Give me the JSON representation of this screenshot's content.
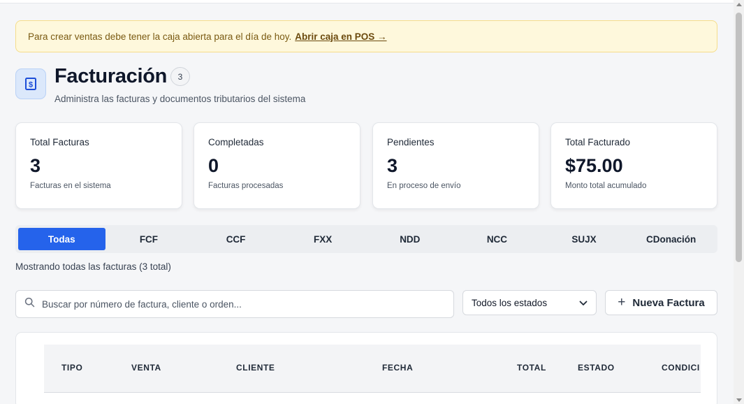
{
  "alert": {
    "message": "Para crear ventas debe tener la caja abierta para el día de hoy.",
    "link": "Abrir caja en POS →"
  },
  "header": {
    "icon": "dollar-receipt-icon",
    "title": "Facturación",
    "count": "3",
    "subtitle": "Administra las facturas y documentos tributarios del sistema"
  },
  "stats": [
    {
      "label": "Total Facturas",
      "value": "3",
      "desc": "Facturas en el sistema"
    },
    {
      "label": "Completadas",
      "value": "0",
      "desc": "Facturas procesadas"
    },
    {
      "label": "Pendientes",
      "value": "3",
      "desc": "En proceso de envío"
    },
    {
      "label": "Total Facturado",
      "value": "$75.00",
      "desc": "Monto total acumulado"
    }
  ],
  "tabs": [
    "Todas",
    "FCF",
    "CCF",
    "FXX",
    "NDD",
    "NCC",
    "SUJX",
    "CDonación"
  ],
  "showing": "Mostrando todas las facturas (3 total)",
  "search": {
    "placeholder": "Buscar por número de factura, cliente o orden..."
  },
  "status_filter": {
    "selected": "Todos los estados"
  },
  "new_button": {
    "label": "Nueva Factura"
  },
  "table": {
    "headers": [
      "TIPO",
      "VENTA",
      "CLIENTE",
      "FECHA",
      "TOTAL",
      "ESTADO",
      "CONDICI"
    ]
  },
  "colors": {
    "accent": "#2563eb",
    "alert_bg": "#fef8dc",
    "alert_border": "#f5dd8a"
  }
}
